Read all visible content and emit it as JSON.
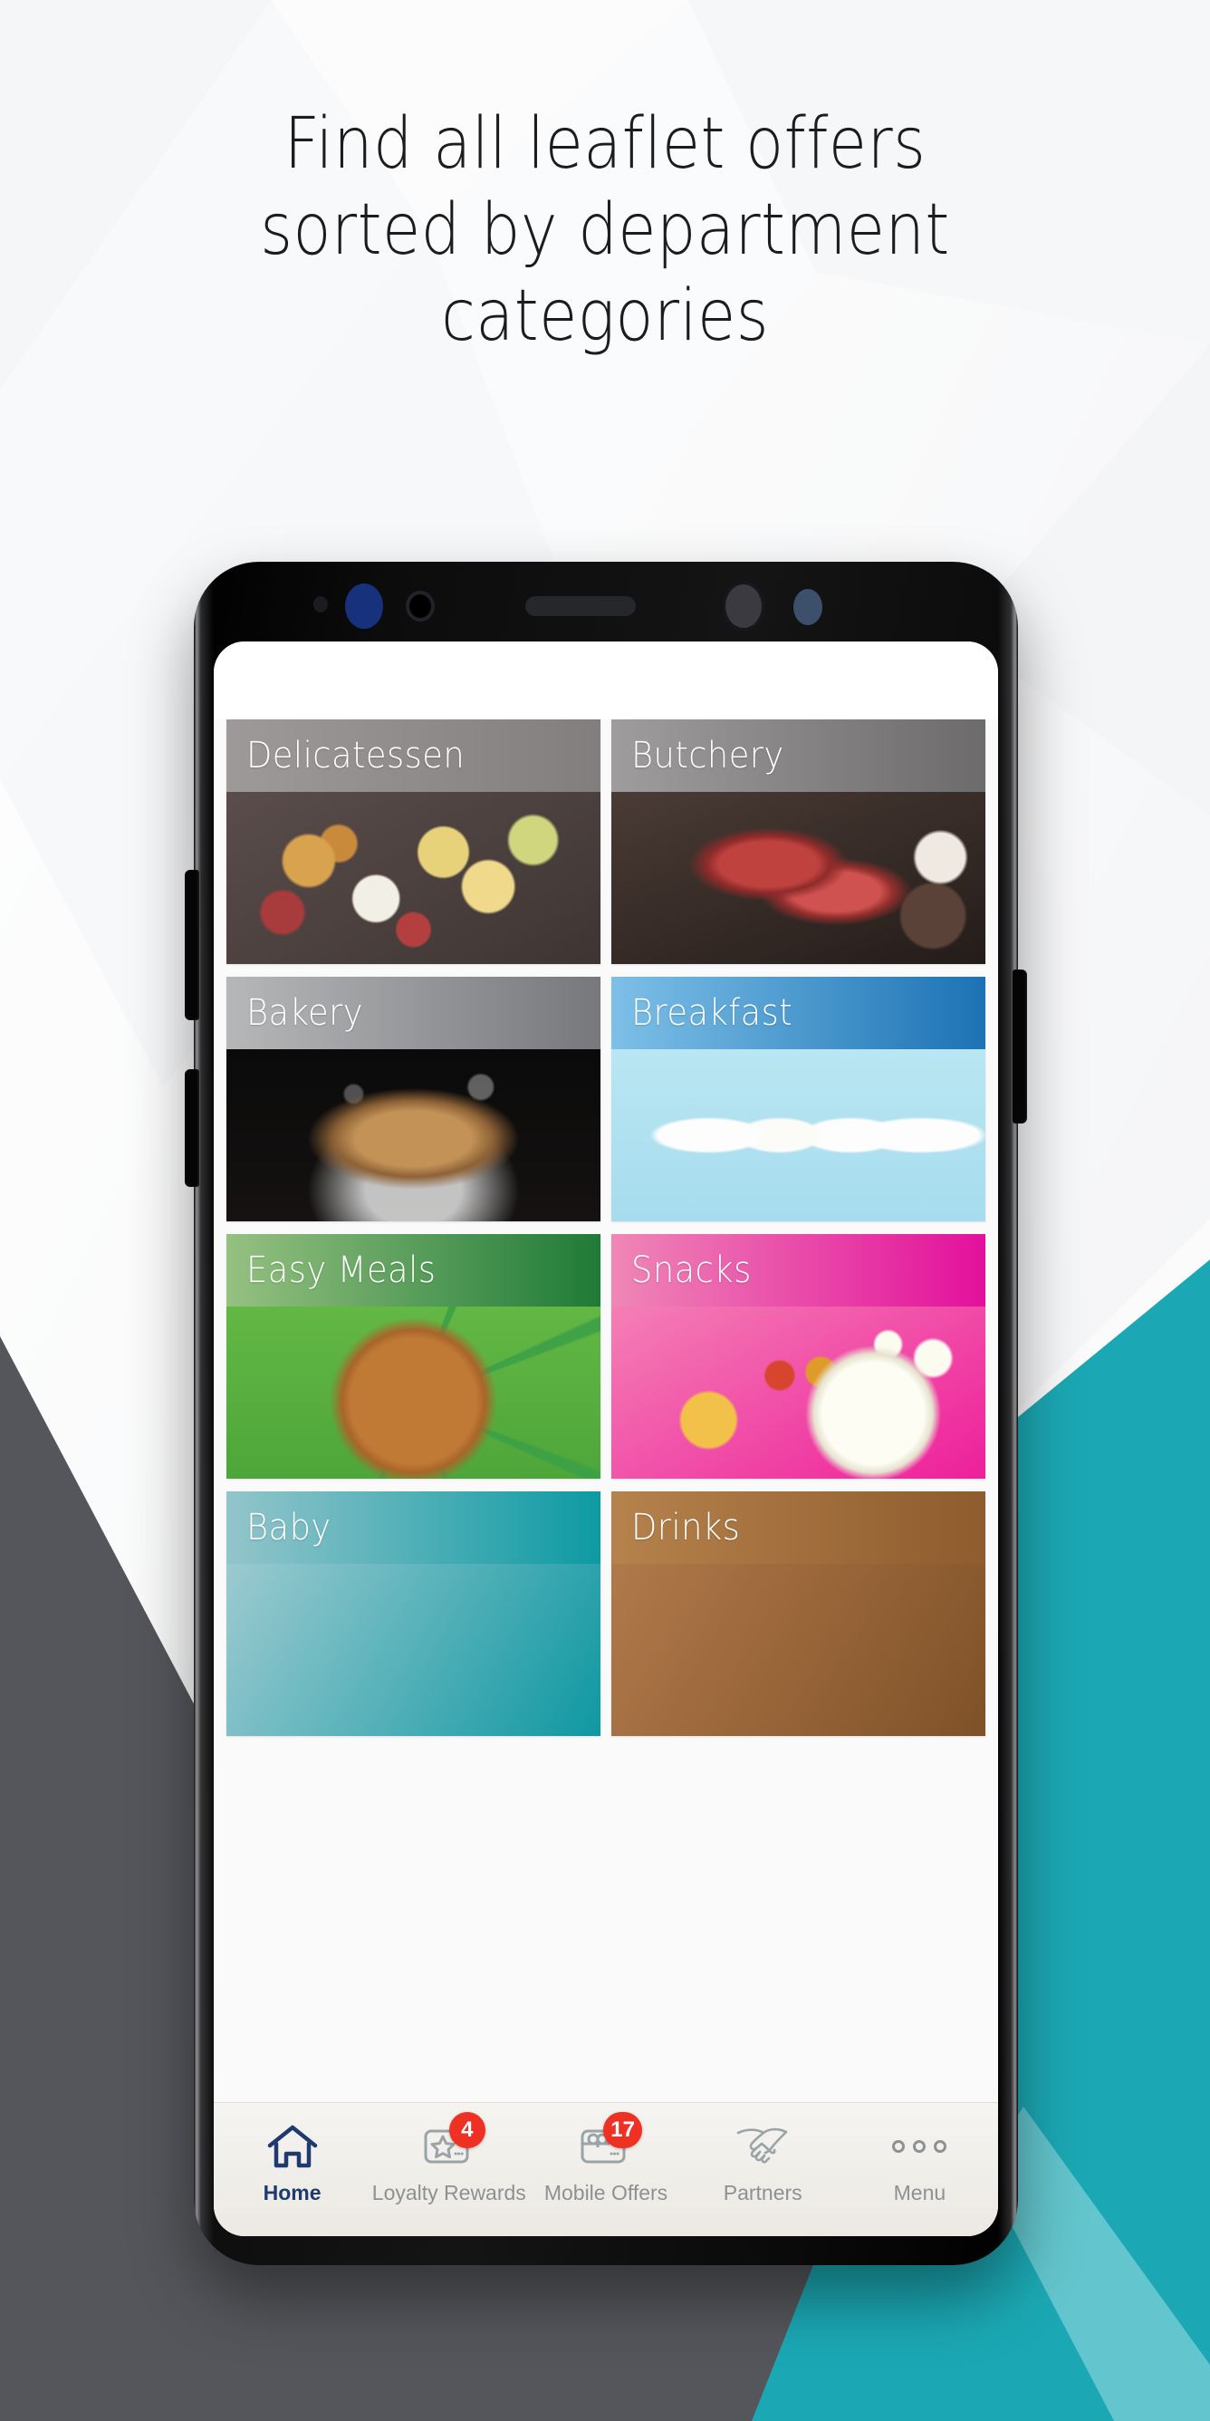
{
  "headline": {
    "line1": "Find all leaflet offers",
    "line2": "sorted by department",
    "line3": "categories"
  },
  "colors": {
    "teal": "#1ba8b4",
    "teal_light": "#63c5cd",
    "dark_gray": "#55565b",
    "badge_red": "#ef3124",
    "nav_active": "#1f3a6e",
    "nav_inactive": "#8e9192"
  },
  "phone": {
    "bezel": {
      "sensor_small": "proximity-sensor",
      "sensor_blue": "iris-scanner",
      "sensor_ring": "ir-emitter",
      "speaker": "earpiece-speaker",
      "camera": "front-camera",
      "sensor_blue2": "light-sensor"
    }
  },
  "app": {
    "categories": [
      {
        "label": "Delicatessen",
        "head_class": "head-deli",
        "photo_class": "ph-deli"
      },
      {
        "label": "Butchery",
        "head_class": "head-butch",
        "photo_class": "ph-butch"
      },
      {
        "label": "Bakery",
        "head_class": "head-bakery",
        "photo_class": "ph-bakery"
      },
      {
        "label": "Breakfast",
        "head_class": "head-break",
        "photo_class": "ph-break"
      },
      {
        "label": "Easy Meals",
        "head_class": "head-easy",
        "photo_class": "ph-easy"
      },
      {
        "label": "Snacks",
        "head_class": "head-snack",
        "photo_class": "ph-snack"
      },
      {
        "label": "Baby",
        "head_class": "head-baby",
        "photo_class": "ph-baby"
      },
      {
        "label": "Drinks",
        "head_class": "head-drinks",
        "photo_class": "ph-drinks"
      }
    ],
    "bottom_nav": [
      {
        "label": "Home",
        "icon": "home-icon",
        "badge": null,
        "active": true
      },
      {
        "label": "Loyalty Rewards",
        "icon": "star-card-icon",
        "badge": "4",
        "active": false
      },
      {
        "label": "Mobile Offers",
        "icon": "gift-card-icon",
        "badge": "17",
        "active": false
      },
      {
        "label": "Partners",
        "icon": "handshake-icon",
        "badge": null,
        "active": false
      },
      {
        "label": "Menu",
        "icon": "more-dots-icon",
        "badge": null,
        "active": false
      }
    ]
  }
}
